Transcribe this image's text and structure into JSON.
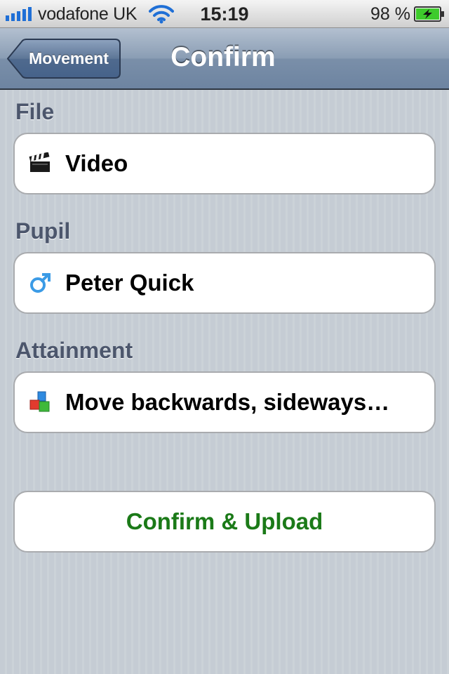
{
  "status_bar": {
    "carrier": "vodafone UK",
    "time": "15:19",
    "battery_percent": "98 %",
    "signal_icon": "signal-bars-icon",
    "wifi_icon": "wifi-icon",
    "battery_icon": "battery-charging-icon"
  },
  "nav_bar": {
    "back_label": "Movement",
    "title": "Confirm"
  },
  "sections": {
    "file": {
      "header": "File",
      "value": "Video",
      "icon": "clapperboard-icon"
    },
    "pupil": {
      "header": "Pupil",
      "value": "Peter Quick",
      "icon": "male-symbol-icon"
    },
    "attainment": {
      "header": "Attainment",
      "value": "Move backwards, sideways…",
      "icon": "building-blocks-icon"
    }
  },
  "actions": {
    "confirm_upload_label": "Confirm & Upload"
  },
  "colors": {
    "nav_bar": "#7a8fa9",
    "section_header": "#4c566c",
    "action_text": "#1b7a18",
    "background": "#c5ccd4"
  }
}
